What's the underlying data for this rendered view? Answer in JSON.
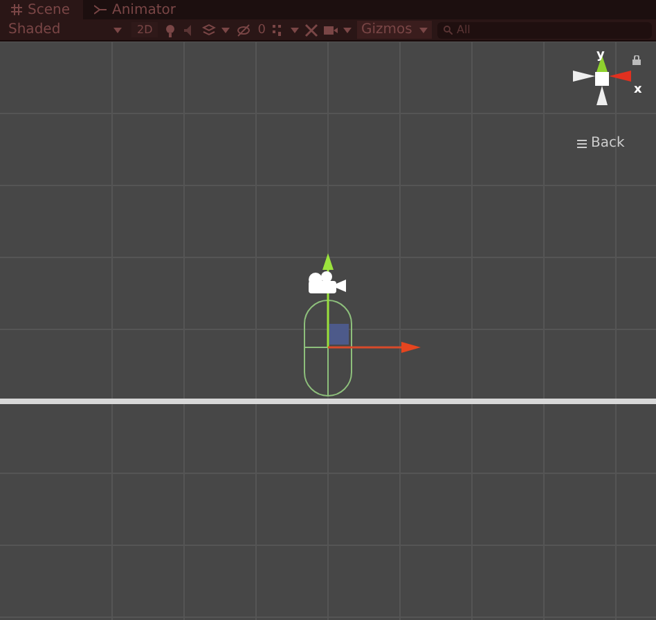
{
  "tabs": [
    {
      "label": "Scene",
      "selected": true
    },
    {
      "label": "Animator",
      "selected": false
    }
  ],
  "toolbar": {
    "shading": "Shaded",
    "mode_2d": {
      "label": "2D",
      "on": false
    },
    "hidden_count": "0",
    "gizmos": "Gizmos",
    "search": {
      "placeholder": "All"
    }
  },
  "orientation_gizmo": {
    "y_label": "y",
    "x_label": "x",
    "back": "Back"
  }
}
